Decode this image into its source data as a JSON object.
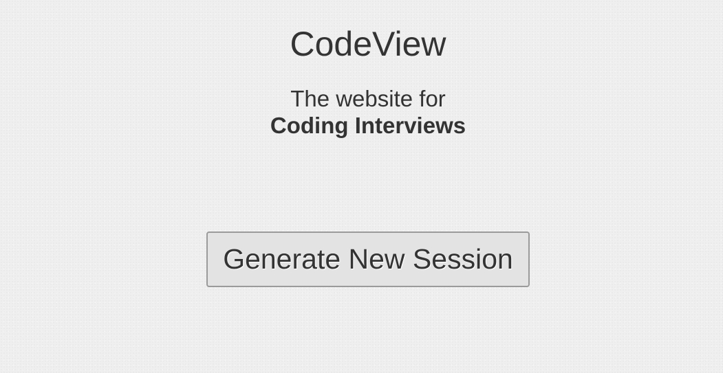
{
  "brand": {
    "title": "CodeView"
  },
  "tagline": {
    "line1": "The website for",
    "line2": "Coding Interviews"
  },
  "actions": {
    "generate_label": "Generate New Session"
  },
  "colors": {
    "background": "#efefef",
    "text": "#333333",
    "button_background": "#e3e3e3",
    "button_border": "#9a9a9a"
  }
}
